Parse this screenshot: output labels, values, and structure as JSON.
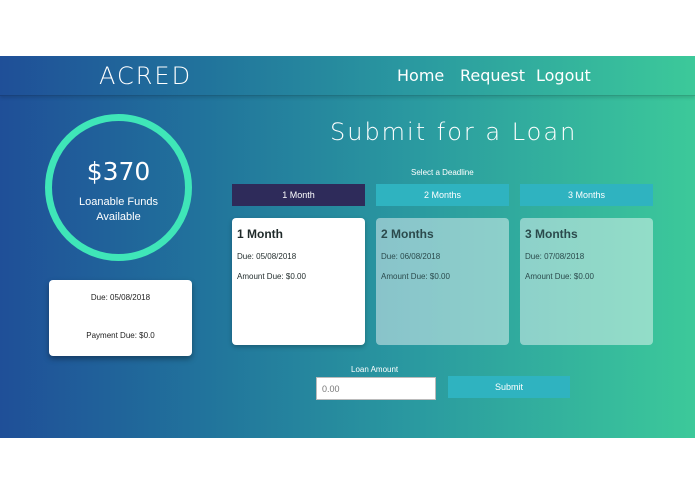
{
  "navbar": {
    "brand": "ACRED",
    "links": [
      {
        "label": "Home"
      },
      {
        "label": "Request"
      },
      {
        "label": "Logout"
      }
    ]
  },
  "funds": {
    "amount": "$370",
    "label": "Loanable Funds Available"
  },
  "due_card": {
    "due": "Due: 05/08/2018",
    "payment": "Payment Due: $0.0"
  },
  "page": {
    "heading": "Submit for a Loan",
    "deadline_label": "Select a Deadline"
  },
  "deadline_options": [
    {
      "label": "1 Month"
    },
    {
      "label": "2 Months"
    },
    {
      "label": "3 Months"
    }
  ],
  "plans": [
    {
      "title": "1 Month",
      "due": "Due: 05/08/2018",
      "amount": "Amount Due: $0.00"
    },
    {
      "title": "2 Months",
      "due": "Due: 06/08/2018",
      "amount": "Amount Due: $0.00"
    },
    {
      "title": "3 Months",
      "due": "Due: 07/08/2018",
      "amount": "Amount Due: $0.00"
    }
  ],
  "loan": {
    "label": "Loan Amount",
    "placeholder": "0.00",
    "value": "",
    "submit_label": "Submit"
  },
  "colors": {
    "accent_ring": "#3fe6b8",
    "selected_button": "#2e2b5a",
    "button": "#2fb3c0"
  }
}
